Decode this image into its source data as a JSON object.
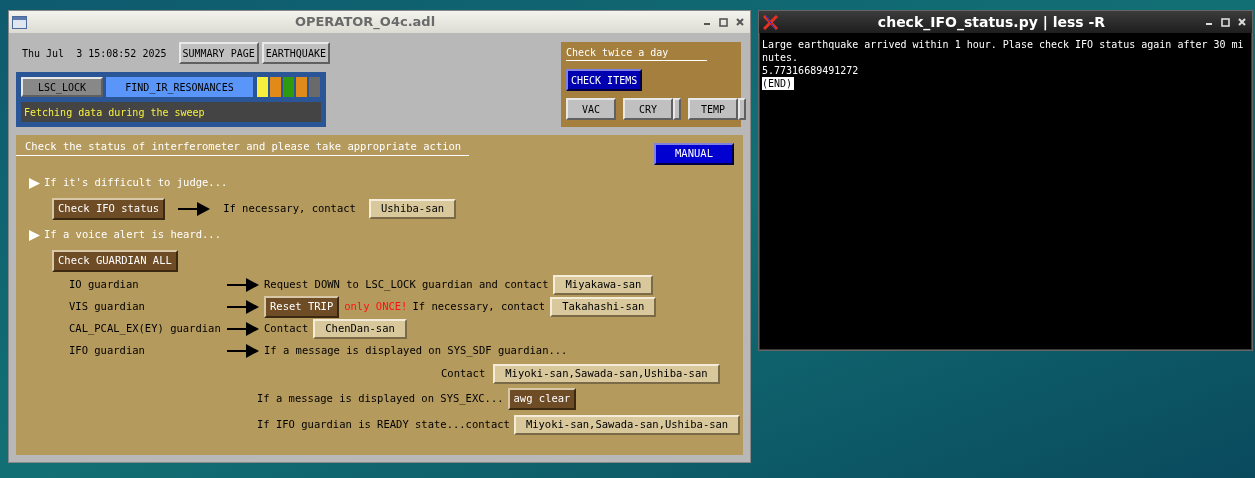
{
  "operator_window": {
    "title": "OPERATOR_O4c.adl",
    "datetime": "Thu Jul  3 15:08:52 2025",
    "top_buttons": [
      "SUMMARY PAGE",
      "EARTHQUAKE"
    ],
    "guardian": {
      "state_button": "LSC_LOCK",
      "current_state": "FIND_IR_RESONANCES",
      "indicators": [
        {
          "color": "#f7f03c"
        },
        {
          "color": "#e08a1a"
        },
        {
          "color": "#2e9a10"
        },
        {
          "color": "#e08a1a"
        },
        {
          "color": "#6a6a6a"
        }
      ],
      "message": "Fetching data during the sweep"
    },
    "check_panel": {
      "title": "Check twice a day",
      "main_button": "CHECK ITEMS",
      "buttons": [
        {
          "label": "VAC",
          "has_menu": false
        },
        {
          "label": "CRY",
          "has_menu": true
        },
        {
          "label": "TEMP",
          "has_menu": true
        }
      ]
    },
    "action_panel": {
      "title": "Check the status of interferometer and please take appropriate action",
      "manual_button": "MANUAL",
      "rows": [
        {
          "kind": "heading",
          "text": "If it's difficult to judge..."
        },
        {
          "kind": "step",
          "parts": [
            {
              "kind": "action",
              "text": "Check IFO status"
            },
            {
              "kind": "arrow"
            },
            {
              "kind": "text",
              "text": "If necessary, contact"
            },
            {
              "kind": "contact",
              "text": "Ushiba-san"
            }
          ]
        },
        {
          "kind": "heading",
          "text": "If a voice alert is heard..."
        },
        {
          "kind": "step",
          "parts": [
            {
              "kind": "action",
              "text": "Check GUARDIAN ALL"
            }
          ]
        },
        {
          "kind": "guardian",
          "label": "IO guardian",
          "parts": [
            {
              "kind": "arrow"
            },
            {
              "kind": "text",
              "text": "Request DOWN to LSC_LOCK guardian and contact"
            },
            {
              "kind": "contact",
              "text": "Miyakawa-san"
            }
          ]
        },
        {
          "kind": "guardian",
          "label": "VIS guardian",
          "parts": [
            {
              "kind": "arrow"
            },
            {
              "kind": "action",
              "text": "Reset TRIP"
            },
            {
              "kind": "warning",
              "text": "only ONCE!"
            },
            {
              "kind": "text",
              "text": "If necessary, contact"
            },
            {
              "kind": "contact",
              "text": "Takahashi-san"
            }
          ]
        },
        {
          "kind": "guardian",
          "label": "CAL_PCAL_EX(EY) guardian",
          "parts": [
            {
              "kind": "arrow"
            },
            {
              "kind": "text",
              "text": "Contact"
            },
            {
              "kind": "contact",
              "text": "ChenDan-san"
            }
          ]
        },
        {
          "kind": "guardian",
          "label": "IFO guardian",
          "parts": [
            {
              "kind": "arrow"
            },
            {
              "kind": "text",
              "text": "If a message is displayed on SYS_SDF guardian..."
            }
          ]
        },
        {
          "kind": "contact_line",
          "parts": [
            {
              "kind": "text",
              "text": "Contact"
            },
            {
              "kind": "contact",
              "text": "Miyoki-san,Sawada-san,Ushiba-san"
            }
          ]
        },
        {
          "kind": "followup",
          "parts": [
            {
              "kind": "text",
              "text": "If a message is displayed on SYS_EXC..."
            },
            {
              "kind": "action",
              "text": "awg clear"
            }
          ]
        },
        {
          "kind": "followup",
          "parts": [
            {
              "kind": "text",
              "text": "If IFO guardian is READY state...contact"
            },
            {
              "kind": "contact",
              "text": "Miyoki-san,Sawada-san,Ushiba-san"
            }
          ]
        }
      ]
    }
  },
  "terminal_window": {
    "title": "check_IFO_status.py | less -R",
    "lines": [
      "Large earthquake arrived within 1 hour. Plase check IFO status again after 30 mi",
      "nutes.",
      "5.77316689491272"
    ],
    "prompt": "(END)"
  }
}
